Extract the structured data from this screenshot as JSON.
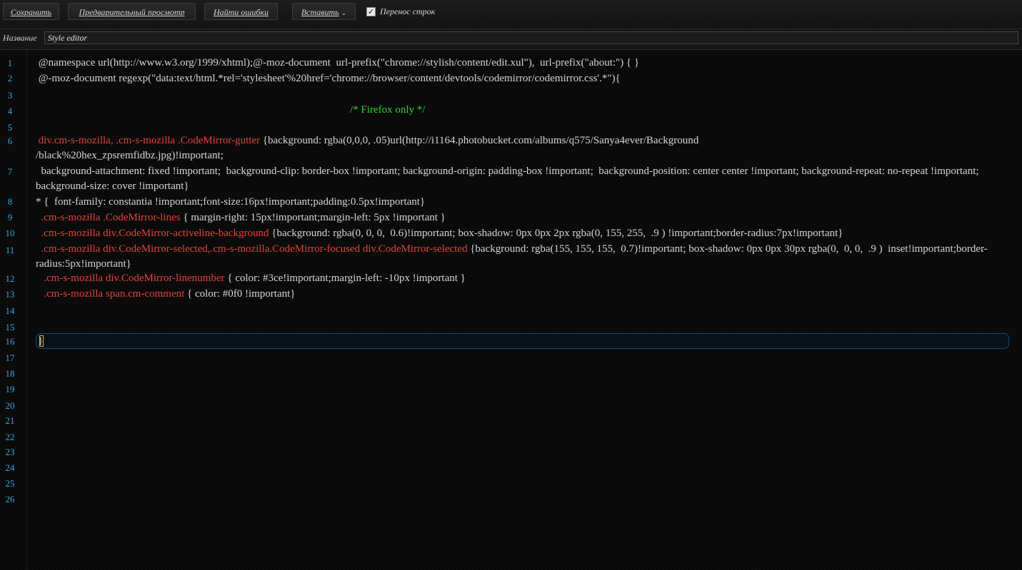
{
  "toolbar": {
    "save": "Сохранить",
    "preview": "Предварительный просмотр",
    "find_errors": "Найти ошибки",
    "insert": "Вставить",
    "word_wrap": "Перенос строк",
    "word_wrap_checked": true
  },
  "namebar": {
    "label": "Название",
    "value": "Style editor"
  },
  "editor": {
    "line_numbers": [
      "1",
      "2",
      "3",
      "4",
      "5",
      "6",
      "7",
      "8",
      "9",
      "10",
      "11",
      "12",
      "13",
      "14",
      "15",
      "16",
      "17",
      "18",
      "19",
      "20",
      "21",
      "22",
      "23",
      "24",
      "25",
      "26"
    ],
    "lines": {
      "l1": " @namespace url(http://www.w3.org/1999/xhtml);@-moz-document  url-prefix(\"chrome://stylish/content/edit.xul\"),  url-prefix(\"about:\") { }",
      "l2": " @-moz-document regexp(\"data:text/html.*rel='stylesheet'%20href='chrome://browser/content/devtools/codemirror/codemirror.css'.*\"){",
      "l4": "/* Firefox only */",
      "l6_sel": " div.cm-s-mozilla, .cm-s-mozilla .CodeMirror-gutter",
      "l6_rest": " {background: rgba(0,0,0, .05)url(http://i1164.photobucket.com/albums/q575/Sanya4ever/Background /black%20hex_zpsremfidbz.jpg)!important;",
      "l7": "  background-attachment: fixed !important;  background-clip: border-box !important; background-origin: padding-box !important;  background-position: center center !important; background-repeat: no-repeat !important;  background-size: cover !important}",
      "l8": "* {  font-family: constantia !important;font-size:16px!important;padding:0.5px!important}",
      "l9_sel": "  .cm-s-mozilla .CodeMirror-lines",
      "l9_rest": " { margin-right: 15px!important;margin-left: 5px !important }",
      "l10_sel": "  .cm-s-mozilla div.CodeMirror-activeline-background",
      "l10_rest": " {background: rgba(0, 0, 0,  0.6)!important; box-shadow: 0px 0px 2px rgba(0, 155, 255,  .9 ) !important;border-radius:7px!important}",
      "l11_sel": "  .cm-s-mozilla div.CodeMirror-selected,.cm-s-mozilla.CodeMirror-focused div.CodeMirror-selected",
      "l11_rest": " {background: rgba(155, 155, 155,  0.7)!important; box-shadow: 0px 0px 30px rgba(0,  0, 0,  .9 )  inset!important;border-radius:5px!important}",
      "l12_sel": "   .cm-s-mozilla div.CodeMirror-linenumber",
      "l12_rest": " { color: #3ce!important;margin-left: -10px !important }",
      "l13_sel": "   .cm-s-mozilla span.cm-comment",
      "l13_rest": " { color: #0f0 !important}",
      "l16": "}"
    }
  },
  "colors": {
    "line_number": "#3ea5e0",
    "selector": "#e0443a",
    "comment": "#2fd52f",
    "active_line_border": "#0d4d72"
  }
}
